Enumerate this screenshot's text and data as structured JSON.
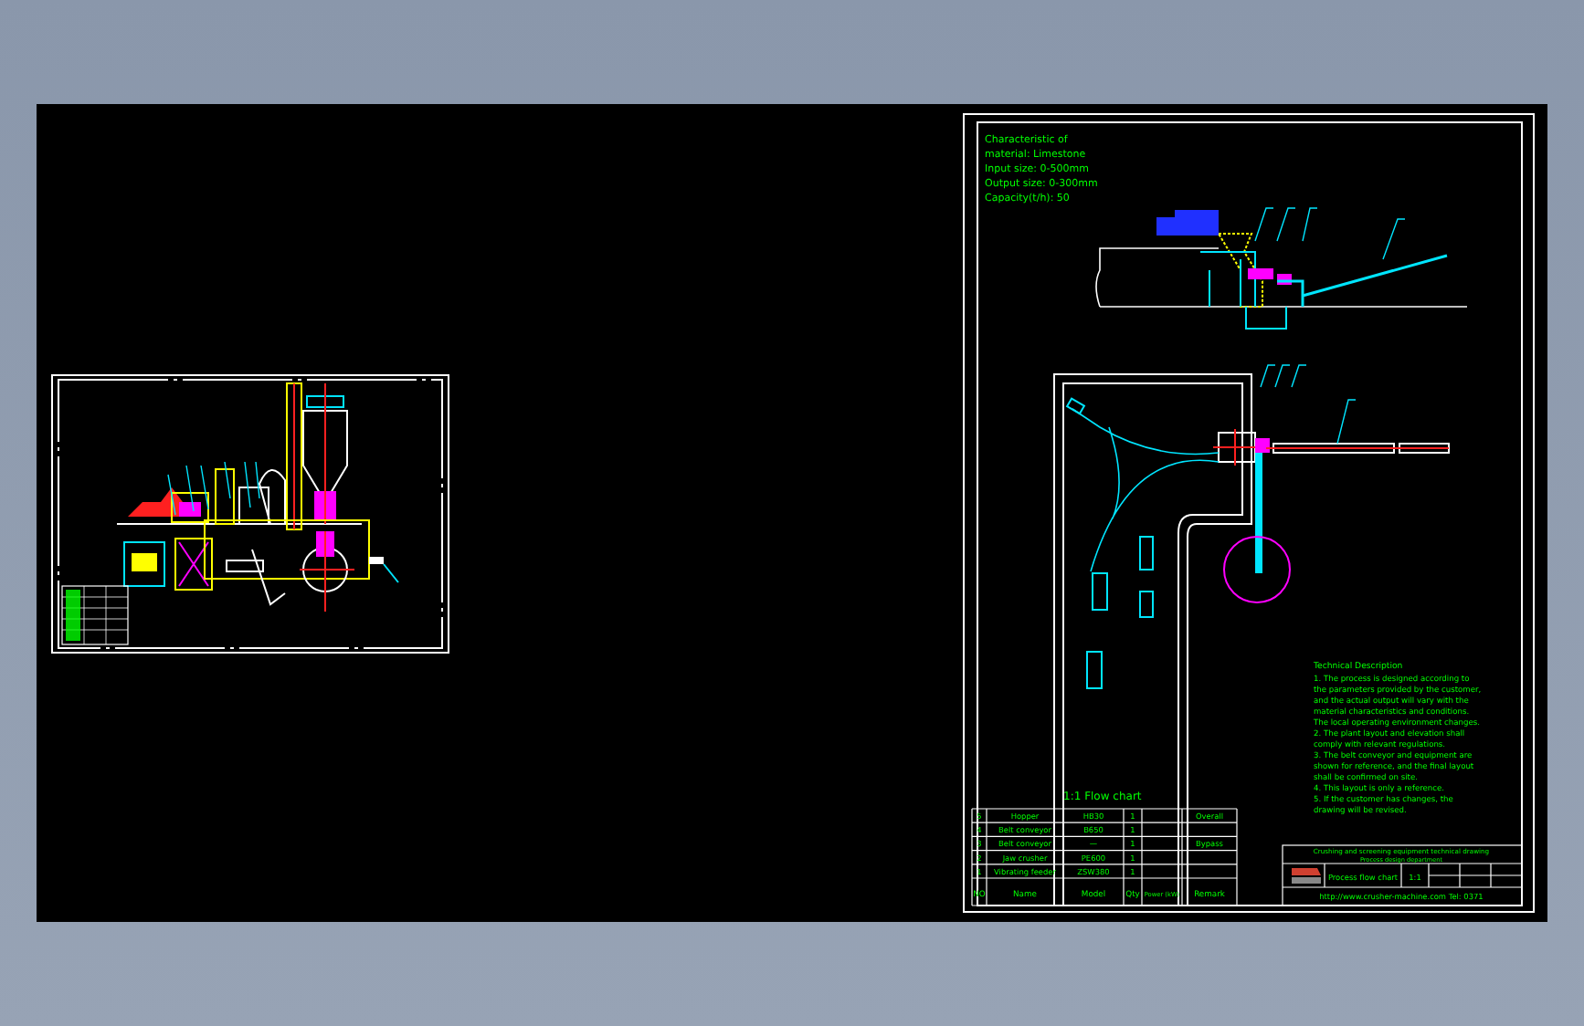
{
  "right_sheet": {
    "material_notes": [
      "Characteristic of",
      "material: Limestone",
      "Input size: 0-500mm",
      "Output size: 0-300mm",
      "Capacity(t/h): 50"
    ],
    "plan_title": "1:1 Flow chart",
    "technical_notes": {
      "heading": "Technical Description",
      "lines": [
        "1. The process is designed according to",
        "the parameters provided by the customer,",
        "and the actual output will vary with the",
        "material characteristics and conditions.",
        "The local operating environment changes.",
        "2. The plant layout and elevation shall",
        "comply with relevant regulations.",
        "3. The belt conveyor and equipment are",
        "shown for reference, and the final layout",
        "shall be confirmed on site.",
        "4. This layout is only a reference.",
        "5. If the customer has changes, the",
        "drawing will be revised."
      ]
    },
    "parts_table": {
      "columns": [
        "NO",
        "Name",
        "Model",
        "Qty",
        "Power (kW)",
        "Remark"
      ],
      "rows": [
        {
          "no": "5",
          "name": "Hopper",
          "model": "HB30",
          "qty": "1",
          "remark": "Overall"
        },
        {
          "no": "4",
          "name": "Belt conveyor",
          "model": "B650",
          "qty": "1"
        },
        {
          "no": "3",
          "name": "Belt conveyor",
          "model": "—",
          "qty": "1",
          "remark": "Bypass"
        },
        {
          "no": "2",
          "name": "Jaw crusher",
          "model": "PE600",
          "qty": "1"
        },
        {
          "no": "1",
          "name": "Vibrating feeder",
          "model": "ZSW380",
          "qty": "1"
        }
      ]
    },
    "title_block": {
      "company": "Crushing and screening equipment technical drawing",
      "company_line2": "Process design department",
      "title": "Process flow chart",
      "scale": "1:1",
      "address": "http://www.crusher-machine.com  Tel: 0371"
    }
  }
}
